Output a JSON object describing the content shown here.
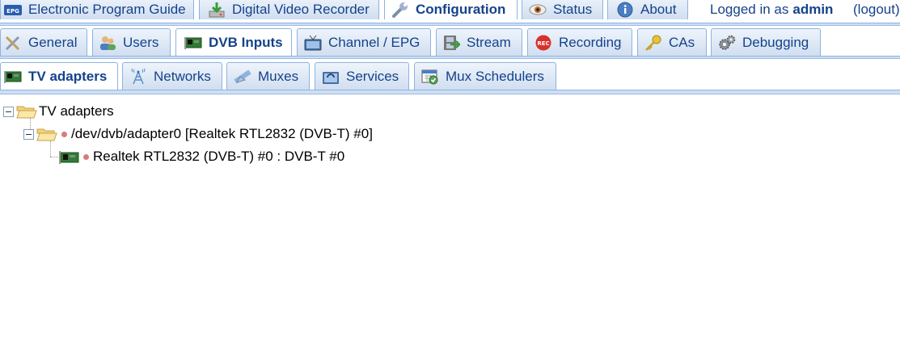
{
  "top_nav": {
    "tabs": [
      {
        "label": "Electronic Program Guide",
        "icon": "epg-icon"
      },
      {
        "label": "Digital Video Recorder",
        "icon": "download-icon"
      },
      {
        "label": "Configuration",
        "icon": "wrench-icon",
        "active": true
      },
      {
        "label": "Status",
        "icon": "eye-icon"
      },
      {
        "label": "About",
        "icon": "info-icon"
      }
    ],
    "logged_in_prefix": "Logged in as",
    "username": "admin",
    "logout_label": "(logout)"
  },
  "config_tabs": [
    {
      "label": "General",
      "icon": "tools-icon"
    },
    {
      "label": "Users",
      "icon": "users-icon"
    },
    {
      "label": "DVB Inputs",
      "icon": "tv-card-icon",
      "active": true
    },
    {
      "label": "Channel / EPG",
      "icon": "tv-icon"
    },
    {
      "label": "Stream",
      "icon": "film-icon"
    },
    {
      "label": "Recording",
      "icon": "rec-icon"
    },
    {
      "label": "CAs",
      "icon": "key-icon"
    },
    {
      "label": "Debugging",
      "icon": "gears-icon"
    }
  ],
  "dvb_tabs": [
    {
      "label": "TV adapters",
      "icon": "tv-card-icon",
      "active": true
    },
    {
      "label": "Networks",
      "icon": "antenna-icon"
    },
    {
      "label": "Muxes",
      "icon": "satellite-icon"
    },
    {
      "label": "Services",
      "icon": "services-icon"
    },
    {
      "label": "Mux Schedulers",
      "icon": "calendar-icon"
    }
  ],
  "tree": {
    "root_label": "TV adapters",
    "adapter_label": "/dev/dvb/adapter0 [Realtek RTL2832 (DVB-T) #0]",
    "frontend_label": "Realtek RTL2832 (DVB-T) #0 : DVB-T #0"
  },
  "colors": {
    "tab_text": "#15428b",
    "tab_border": "#8db2e3",
    "status_dot": "#d97a7a"
  }
}
